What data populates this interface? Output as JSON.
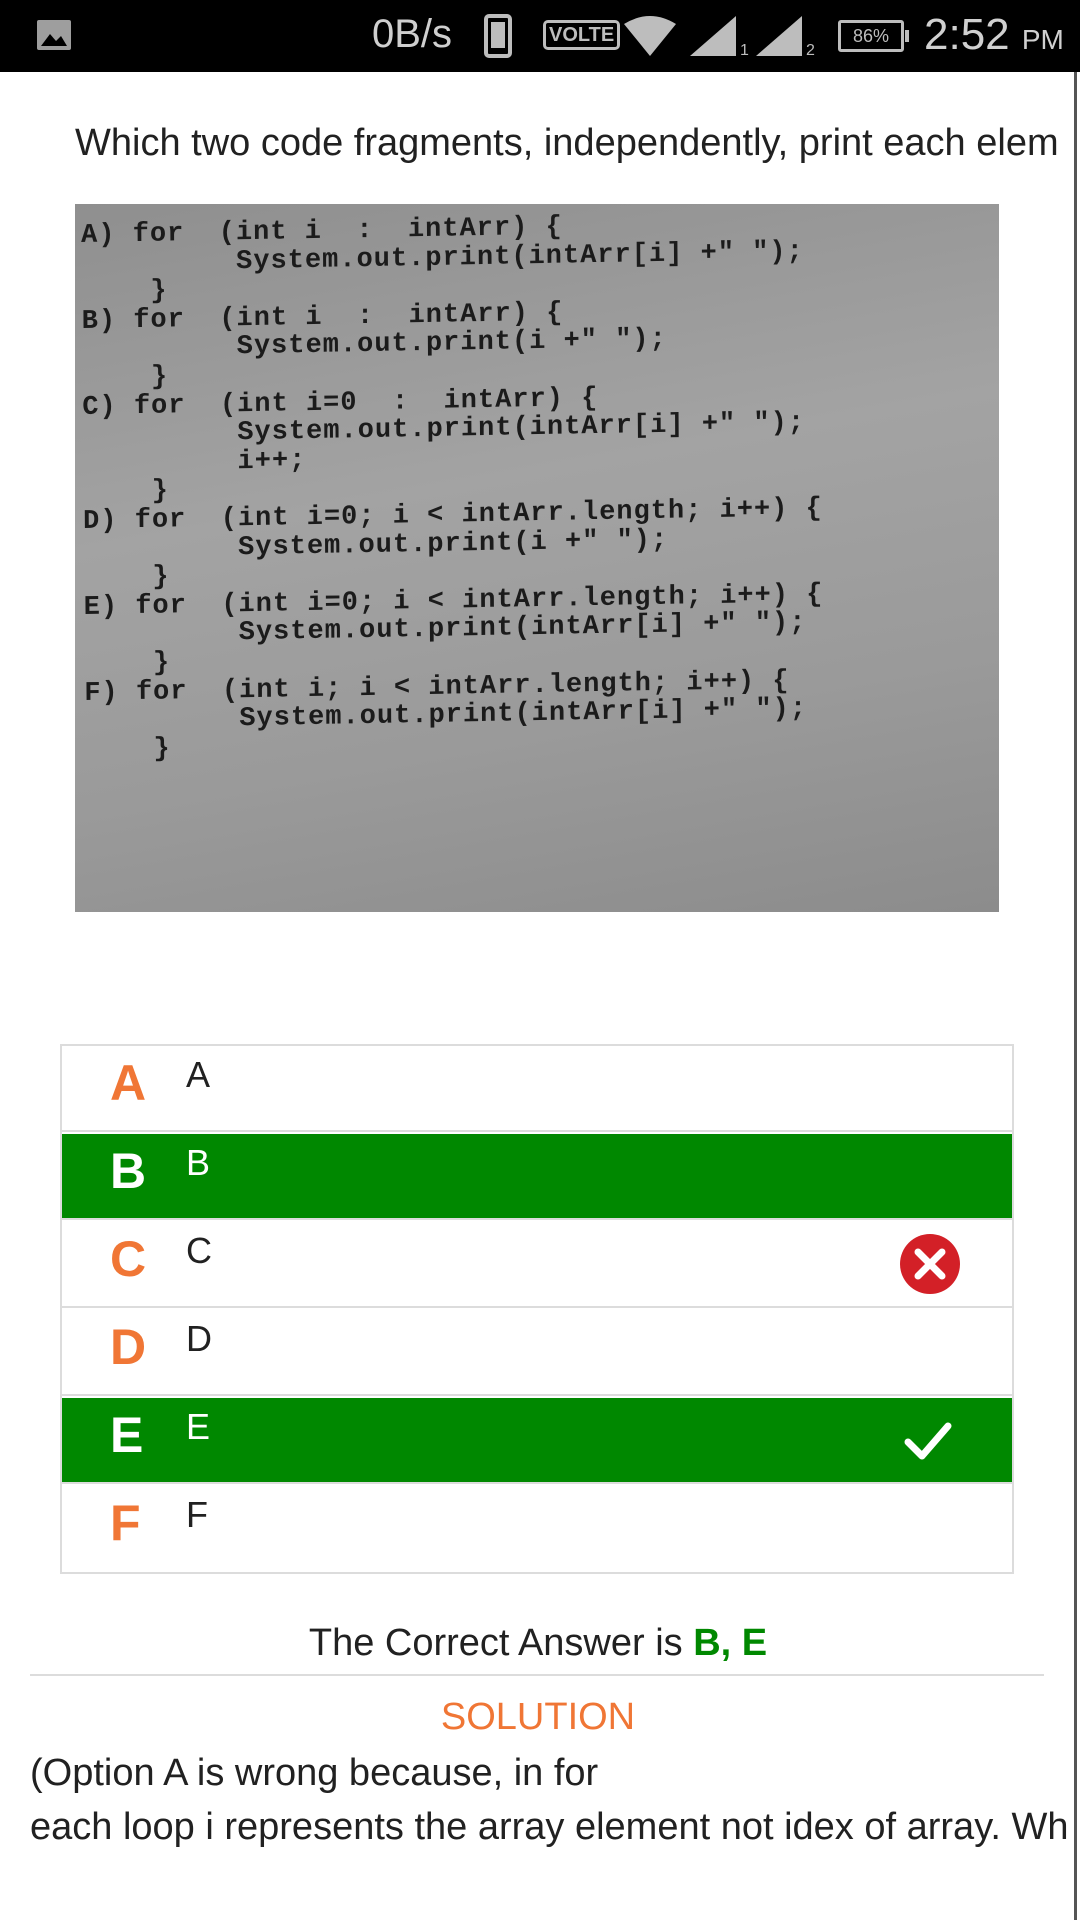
{
  "status_bar": {
    "speed": "0B/s",
    "volte": "VOLTE",
    "sim1": "1",
    "sim2": "2",
    "battery": "86%",
    "time": "2:52",
    "ampm": "PM",
    "icons": [
      "gallery-icon",
      "phone-icon",
      "wifi-icon",
      "signal-icon",
      "signal-icon",
      "battery-icon"
    ]
  },
  "question": {
    "text": "Which two code fragments, independently, print each elem"
  },
  "code_image": {
    "text": "A) for  (int i  :  intArr) {\n         System.out.print(intArr[i] +\" \");\n    }\nB) for  (int i  :  intArr) {\n         System.out.print(i +\" \");\n    }\nC) for  (int i=0  :  intArr) {\n         System.out.print(intArr[i] +\" \");\n         i++;\n    }\nD) for  (int i=0; i < intArr.length; i++) {\n         System.out.print(i +\" \");\n    }\nE) for  (int i=0; i < intArr.length; i++) {\n         System.out.print(intArr[i] +\" \");\n    }\nF) for  (int i; i < intArr.length; i++) {\n         System.out.print(intArr[i] +\" \");\n    }"
  },
  "options": [
    {
      "letter": "A",
      "text": "A",
      "state": "neutral"
    },
    {
      "letter": "B",
      "text": "B",
      "state": "correct"
    },
    {
      "letter": "C",
      "text": "C",
      "state": "wrong-selected"
    },
    {
      "letter": "D",
      "text": "D",
      "state": "neutral"
    },
    {
      "letter": "E",
      "text": "E",
      "state": "correct-selected"
    },
    {
      "letter": "F",
      "text": "F",
      "state": "neutral"
    }
  ],
  "answer": {
    "prefix": "The Correct Answer is ",
    "value": "B, E"
  },
  "solution": {
    "title": "SOLUTION",
    "line1": "(Option A is wrong because, in for",
    "line2": "each loop i represents the array element not idex of array. Wh"
  },
  "colors": {
    "accent_orange": "#f07635",
    "correct_green": "#008800",
    "wrong_red": "#d32027"
  }
}
